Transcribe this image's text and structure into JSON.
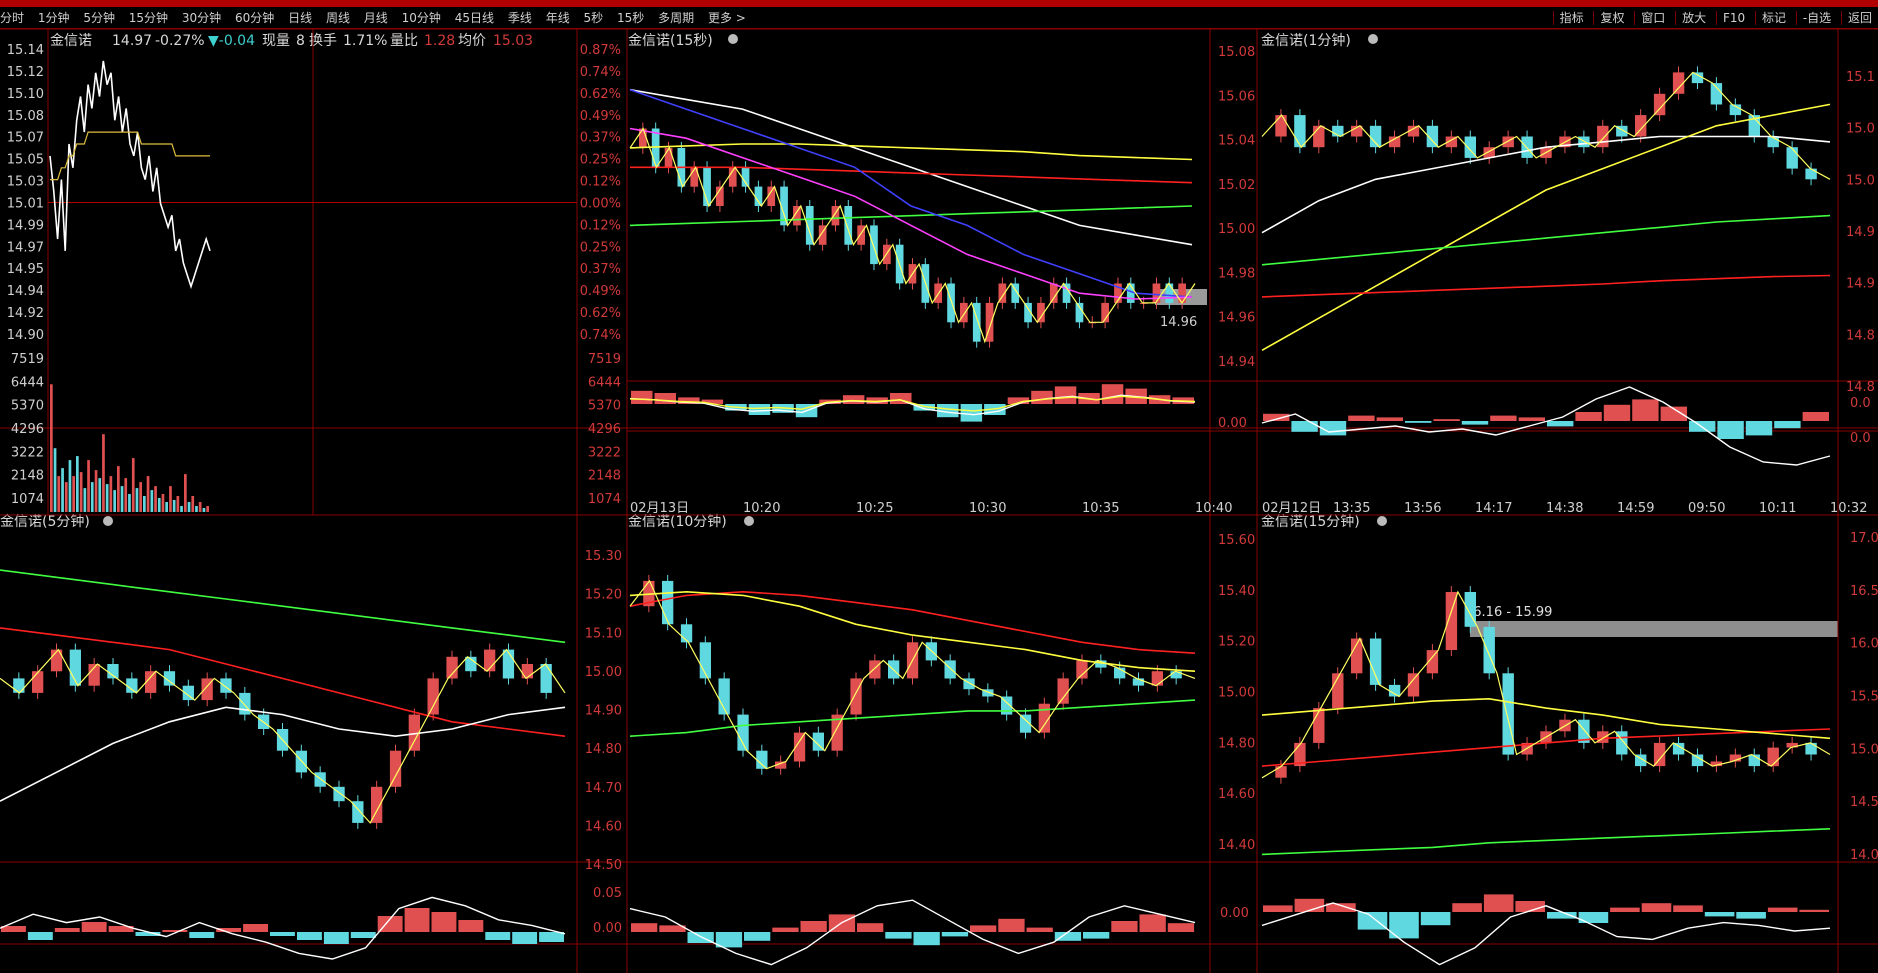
{
  "toolbar": {
    "periods": [
      "分时",
      "1分钟",
      "5分钟",
      "15分钟",
      "30分钟",
      "60分钟",
      "日线",
      "周线",
      "月线",
      "10分钟",
      "45日线",
      "季线",
      "年线",
      "5秒",
      "15秒",
      "多周期",
      "更多 >"
    ],
    "tools": [
      "指标",
      "复权",
      "窗口",
      "放大",
      "F10",
      "标记",
      "-自选",
      "返回"
    ]
  },
  "colors": {
    "frame": "#8a0000",
    "up": "#e05050",
    "down": "#60d8e0",
    "ma1": "#ffffff",
    "ma2": "#ffff40",
    "ma3": "#ff40ff",
    "ma4": "#40ff40",
    "ma5": "#4040ff",
    "ma6": "#ff2020"
  },
  "chart_data": [
    {
      "panel": "intraday",
      "type": "line",
      "title": "金信诺",
      "header": {
        "price": "14.97",
        "pct": "-0.27%",
        "change": "▼-0.04",
        "vol_label": "现量",
        "vol": "8",
        "turnover_label": "换手",
        "turnover": "1.71%",
        "ratio_label": "量比",
        "ratio": "1.28",
        "avg_label": "均价",
        "avg": "15.03"
      },
      "yticks_left": [
        "15.14",
        "15.12",
        "15.10",
        "15.08",
        "15.07",
        "15.05",
        "15.03",
        "15.01",
        "14.99",
        "14.97",
        "14.95",
        "14.94",
        "14.92",
        "14.90"
      ],
      "yticks_right": [
        "0.87%",
        "0.74%",
        "0.62%",
        "0.49%",
        "0.37%",
        "0.25%",
        "0.12%",
        "0.00%",
        "0.12%",
        "0.25%",
        "0.37%",
        "0.49%",
        "0.62%",
        "0.74%"
      ],
      "vol_ticks": [
        "7519",
        "6444",
        "5370",
        "4296",
        "3222",
        "2148",
        "1074"
      ],
      "ylim": [
        14.9,
        15.14
      ],
      "price": [
        15.05,
        15.02,
        14.98,
        15.03,
        14.97,
        15.06,
        15.04,
        15.08,
        15.1,
        15.07,
        15.11,
        15.09,
        15.12,
        15.1,
        15.13,
        15.11,
        15.12,
        15.08,
        15.1,
        15.07,
        15.09,
        15.06,
        15.05,
        15.07,
        15.04,
        15.03,
        15.05,
        15.02,
        15.04,
        15.01,
        15.0,
        14.99,
        15.0,
        14.97,
        14.98,
        14.96,
        14.95,
        14.94,
        14.95,
        14.96,
        14.97,
        14.98,
        14.97
      ],
      "avg": [
        15.03,
        15.03,
        15.03,
        15.04,
        15.04,
        15.05,
        15.05,
        15.06,
        15.06,
        15.06,
        15.07,
        15.07,
        15.07,
        15.07,
        15.07,
        15.07,
        15.07,
        15.07,
        15.07,
        15.07,
        15.07,
        15.07,
        15.07,
        15.07,
        15.06,
        15.06,
        15.06,
        15.06,
        15.06,
        15.06,
        15.06,
        15.06,
        15.06,
        15.05,
        15.05,
        15.05,
        15.05,
        15.05,
        15.05,
        15.05,
        15.05,
        15.05,
        15.05
      ],
      "volume": [
        6400,
        3200,
        1800,
        2200,
        1500,
        2600,
        1800,
        2800,
        2000,
        1200,
        2600,
        1500,
        2100,
        1700,
        3900,
        1400,
        1800,
        1100,
        2300,
        1300,
        1700,
        900,
        2700,
        1200,
        1500,
        800,
        1800,
        1100,
        1300,
        700,
        900,
        500,
        1300,
        600,
        800,
        300,
        1900,
        500,
        800,
        300,
        500,
        200,
        300
      ]
    },
    {
      "panel": "15s",
      "type": "line",
      "title": "金信诺(15秒)",
      "yticks": [
        "15.08",
        "15.06",
        "15.04",
        "15.02",
        "15.00",
        "14.98",
        "14.96",
        "14.94"
      ],
      "ylim": [
        14.93,
        15.09
      ],
      "price_label": "14.96",
      "xticks": [
        "02月13日",
        "10:20",
        "10:25",
        "10:30",
        "10:35",
        "10:40"
      ],
      "close": [
        15.04,
        15.05,
        15.03,
        15.04,
        15.02,
        15.03,
        15.01,
        15.02,
        15.03,
        15.02,
        15.01,
        15.02,
        15.0,
        15.01,
        14.99,
        15.0,
        15.01,
        14.99,
        15.0,
        14.98,
        14.99,
        14.97,
        14.98,
        14.96,
        14.97,
        14.95,
        14.96,
        14.94,
        14.96,
        14.97,
        14.96,
        14.95,
        14.96,
        14.97,
        14.96,
        14.95,
        14.95,
        14.96,
        14.97,
        14.96,
        14.96,
        14.97,
        14.96,
        14.97
      ],
      "ma_white": [
        15.07,
        15.065,
        15.06,
        15.05,
        15.04,
        15.03,
        15.02,
        15.01,
        15.0,
        14.995,
        14.99
      ],
      "ma_yellow": [
        15.04,
        15.041,
        15.042,
        15.042,
        15.041,
        15.04,
        15.039,
        15.038,
        15.036,
        15.035,
        15.034
      ],
      "ma_red": [
        15.03,
        15.03,
        15.03,
        15.029,
        15.028,
        15.027,
        15.026,
        15.025,
        15.024,
        15.023,
        15.022
      ],
      "ma_green": [
        15.0,
        15.001,
        15.002,
        15.003,
        15.004,
        15.005,
        15.006,
        15.007,
        15.008,
        15.009,
        15.01
      ],
      "ma_blue": [
        15.07,
        15.06,
        15.05,
        15.04,
        15.03,
        15.01,
        15.0,
        14.985,
        14.975,
        14.965,
        14.963
      ],
      "ma_magenta": [
        15.05,
        15.045,
        15.035,
        15.025,
        15.015,
        15.0,
        14.985,
        14.975,
        14.965,
        14.962,
        14.963
      ],
      "macd": [
        0.6,
        0.5,
        0.3,
        0.2,
        -0.3,
        -0.5,
        -0.4,
        -0.6,
        0.2,
        0.4,
        0.3,
        0.5,
        -0.3,
        -0.6,
        -0.8,
        -0.5,
        0.3,
        0.6,
        0.8,
        0.5,
        0.9,
        0.7,
        0.4,
        0.3
      ]
    },
    {
      "panel": "1m",
      "type": "line",
      "title": "金信诺(1分钟)",
      "yticks": [
        "15.1",
        "15.0",
        "15.0",
        "14.9",
        "14.9",
        "14.8",
        "14.8"
      ],
      "ylim": [
        14.83,
        15.12
      ],
      "zero": "0.00",
      "macd_ticks": [
        "0.0",
        "0.0"
      ],
      "xticks": [
        "02月12日",
        "13:35",
        "13:56",
        "14:17",
        "14:38",
        "14:59",
        "09:50",
        "10:11",
        "10:32"
      ],
      "close": [
        15.04,
        15.06,
        15.03,
        15.05,
        15.04,
        15.05,
        15.03,
        15.04,
        15.05,
        15.03,
        15.04,
        15.02,
        15.03,
        15.04,
        15.02,
        15.03,
        15.04,
        15.03,
        15.05,
        15.04,
        15.06,
        15.08,
        15.1,
        15.09,
        15.07,
        15.06,
        15.04,
        15.03,
        15.01,
        15.0
      ],
      "ma_white": [
        14.95,
        14.98,
        15.0,
        15.01,
        15.02,
        15.03,
        15.035,
        15.04,
        15.04,
        15.04,
        15.035
      ],
      "ma_yellow": [
        14.84,
        14.87,
        14.9,
        14.93,
        14.96,
        14.99,
        15.01,
        15.03,
        15.05,
        15.06,
        15.07
      ],
      "ma_green": [
        14.92,
        14.925,
        14.93,
        14.935,
        14.94,
        14.945,
        14.95,
        14.955,
        14.96,
        14.963,
        14.966
      ],
      "ma_red": [
        14.89,
        14.892,
        14.894,
        14.896,
        14.898,
        14.9,
        14.902,
        14.905,
        14.907,
        14.909,
        14.91
      ]
    },
    {
      "panel": "5m",
      "type": "line",
      "title": "金信诺(5分钟)",
      "close": [
        15.05,
        15.03,
        15.06,
        15.09,
        15.04,
        15.07,
        15.05,
        15.03,
        15.06,
        15.04,
        15.02,
        15.05,
        15.03,
        15.0,
        14.98,
        14.95,
        14.92,
        14.9,
        14.88,
        14.85,
        14.9,
        14.95,
        15.0,
        15.05,
        15.08,
        15.06,
        15.09,
        15.05,
        15.07,
        15.03
      ],
      "ma_green": [
        15.2,
        15.19,
        15.18,
        15.17,
        15.16,
        15.15,
        15.14,
        15.13,
        15.12,
        15.11,
        15.1
      ],
      "ma_red": [
        15.12,
        15.11,
        15.1,
        15.09,
        15.07,
        15.05,
        15.03,
        15.01,
        14.99,
        14.98,
        14.97
      ],
      "ma_white": [
        14.88,
        14.92,
        14.96,
        14.99,
        15.01,
        15.0,
        14.98,
        14.97,
        14.98,
        15.0,
        15.01
      ]
    },
    {
      "panel": "10m",
      "type": "line",
      "title": "金信诺(10分钟)",
      "yticks": [
        "15.30",
        "15.20",
        "15.10",
        "15.00",
        "14.90",
        "14.80",
        "14.70",
        "14.60",
        "14.50"
      ],
      "ylim": [
        14.45,
        15.35
      ],
      "macd_ticks": [
        "0.05",
        "0.00"
      ],
      "close": [
        15.15,
        15.22,
        15.1,
        15.05,
        14.95,
        14.85,
        14.75,
        14.7,
        14.72,
        14.8,
        14.75,
        14.85,
        14.95,
        15.0,
        14.95,
        15.05,
        15.0,
        14.95,
        14.92,
        14.9,
        14.85,
        14.8,
        14.88,
        14.95,
        15.0,
        14.98,
        14.95,
        14.93,
        14.97,
        14.95
      ],
      "ma_red": [
        15.15,
        15.18,
        15.19,
        15.18,
        15.16,
        15.14,
        15.11,
        15.08,
        15.05,
        15.03,
        15.02
      ],
      "ma_yellow": [
        15.18,
        15.19,
        15.18,
        15.15,
        15.1,
        15.07,
        15.05,
        15.03,
        15.0,
        14.98,
        14.97
      ],
      "ma_green": [
        14.79,
        14.8,
        14.82,
        14.83,
        14.84,
        14.85,
        14.86,
        14.86,
        14.87,
        14.88,
        14.89
      ]
    },
    {
      "panel": "15m",
      "type": "line",
      "title": "金信诺(15分钟)",
      "yticks": [
        "15.60",
        "15.40",
        "15.20",
        "15.00",
        "14.80",
        "14.60",
        "14.40"
      ],
      "yticks_right": [
        "17.0",
        "16.5",
        "16.0",
        "15.5",
        "15.0",
        "14.5",
        "14.0"
      ],
      "ylim": [
        14.3,
        15.7
      ],
      "zero": "0.00",
      "range_label": "16.16 - 15.99",
      "close": [
        14.65,
        14.7,
        14.8,
        14.95,
        15.1,
        15.25,
        15.05,
        15.0,
        15.1,
        15.2,
        15.45,
        15.3,
        15.1,
        14.75,
        14.8,
        14.85,
        14.9,
        14.8,
        14.85,
        14.75,
        14.7,
        14.8,
        14.75,
        14.7,
        14.72,
        14.75,
        14.7,
        14.78,
        14.8,
        14.75
      ],
      "ma_red": [
        14.7,
        14.72,
        14.74,
        14.76,
        14.78,
        14.8,
        14.82,
        14.83,
        14.84,
        14.85,
        14.86
      ],
      "ma_yellow": [
        14.92,
        14.94,
        14.96,
        14.98,
        14.99,
        14.95,
        14.92,
        14.88,
        14.86,
        14.84,
        14.82
      ],
      "ma_green": [
        14.32,
        14.33,
        14.34,
        14.35,
        14.37,
        14.38,
        14.39,
        14.4,
        14.41,
        14.42,
        14.43
      ]
    }
  ]
}
